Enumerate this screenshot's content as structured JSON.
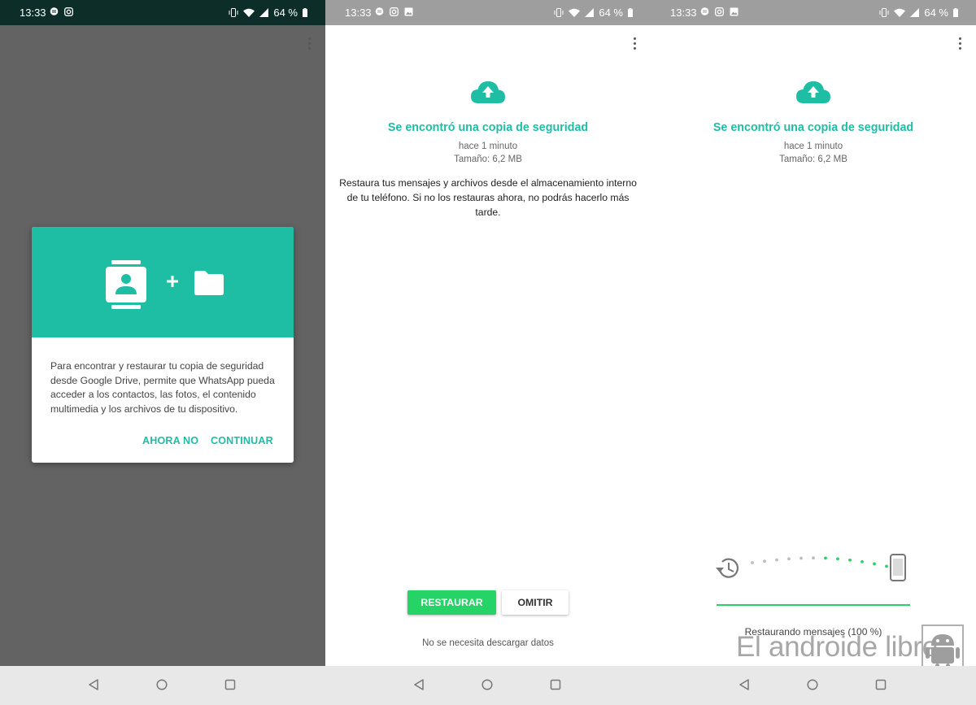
{
  "status_bar": {
    "time": "13:33",
    "battery": "64 %"
  },
  "panel1": {
    "dialog": {
      "text": "Para encontrar y restaurar tu copia de seguridad desde Google Drive, permite que WhatsApp pueda acceder a los contactos, las fotos, el contenido multimedia y los archivos de tu dispositivo.",
      "btn_not_now": "AHORA NO",
      "btn_continue": "CONTINUAR",
      "plus": "+",
      "header_color": "#1ebea5"
    }
  },
  "panel2": {
    "title": "Se encontró una copia de seguridad",
    "time_ago": "hace 1 minuto",
    "size": "Tamaño: 6,2 MB",
    "description": "Restaura tus mensajes y archivos desde el almacenamiento interno de tu teléfono. Si no los restauras ahora, no podrás hacerlo más tarde.",
    "btn_restore": "RESTAURAR",
    "btn_skip": "OMITIR",
    "note": "No se necesita descargar datos"
  },
  "panel3": {
    "title": "Se encontró una copia de seguridad",
    "time_ago": "hace 1 minuto",
    "size": "Tamaño: 6,2 MB",
    "progress_text": "Restaurando mensajes (100 %)",
    "progress_fraction": 1.0
  },
  "watermark": {
    "text": "El androide libre"
  },
  "colors": {
    "accent": "#1ebea5",
    "green": "#25d366"
  },
  "icons": [
    "message-icon",
    "instagram-icon",
    "image-icon",
    "vibrate-icon",
    "wifi-icon",
    "signal-icon",
    "battery-icon",
    "more-vert-icon",
    "contacts-icon",
    "folder-icon",
    "cloud-upload-icon",
    "history-icon",
    "smartphone-icon",
    "back-icon",
    "home-icon",
    "recents-icon"
  ]
}
